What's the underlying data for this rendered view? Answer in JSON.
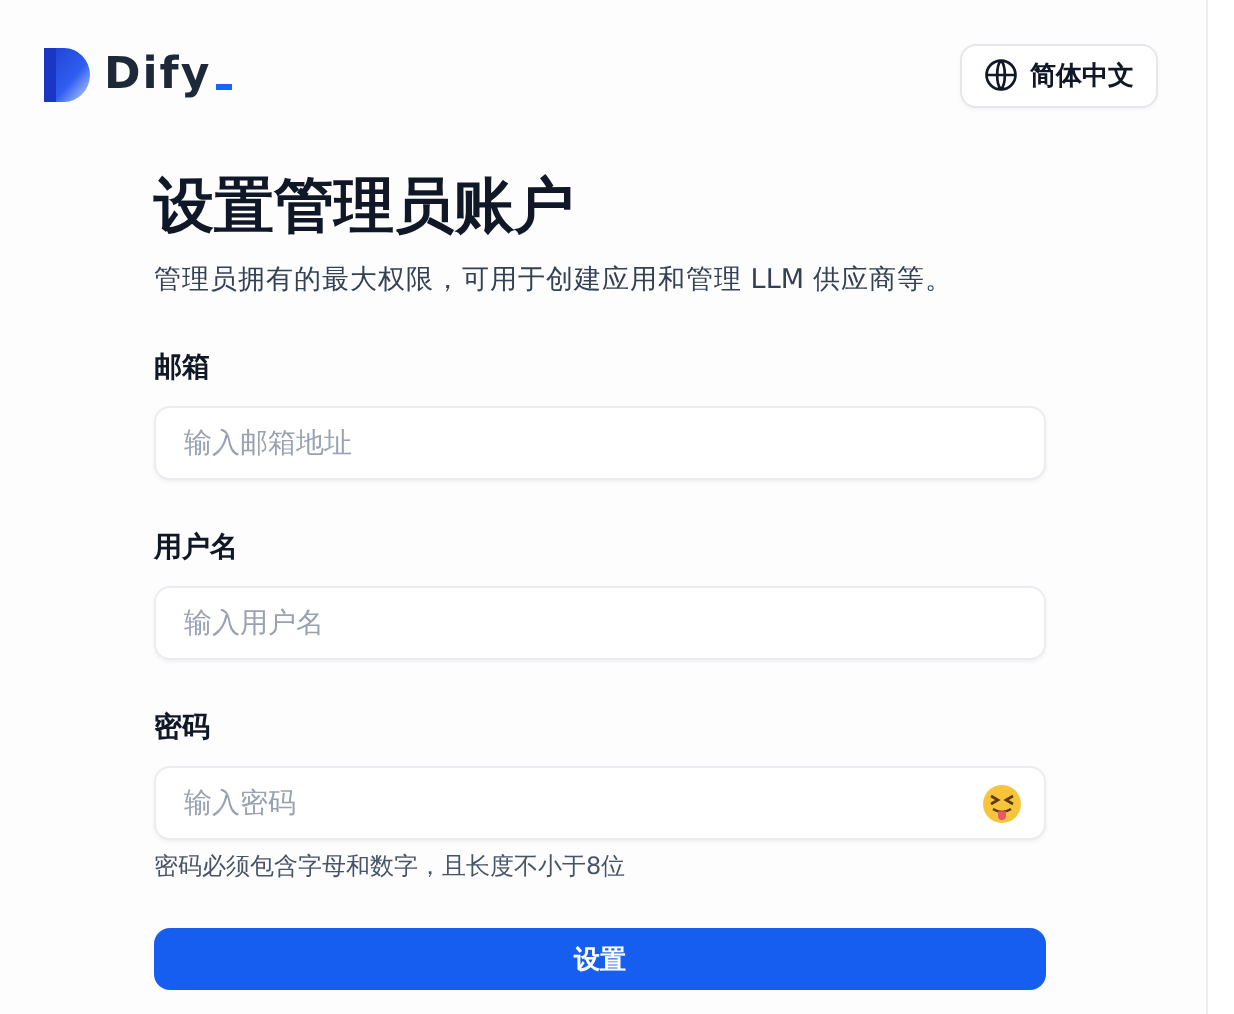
{
  "logo": {
    "text": "Dify"
  },
  "language_button": {
    "label": "简体中文"
  },
  "title": "设置管理员账户",
  "subtitle": "管理员拥有的最大权限，可用于创建应用和管理 LLM 供应商等。",
  "fields": [
    {
      "kind": "text",
      "label": "邮箱",
      "placeholder": "输入邮箱地址"
    },
    {
      "kind": "text",
      "label": "用户名",
      "placeholder": "输入用户名"
    },
    {
      "kind": "password",
      "label": "密码",
      "placeholder": "输入密码",
      "hint": "密码必须包含字母和数字，且长度不小于8位"
    }
  ],
  "submit_button": {
    "label": "设置"
  }
}
